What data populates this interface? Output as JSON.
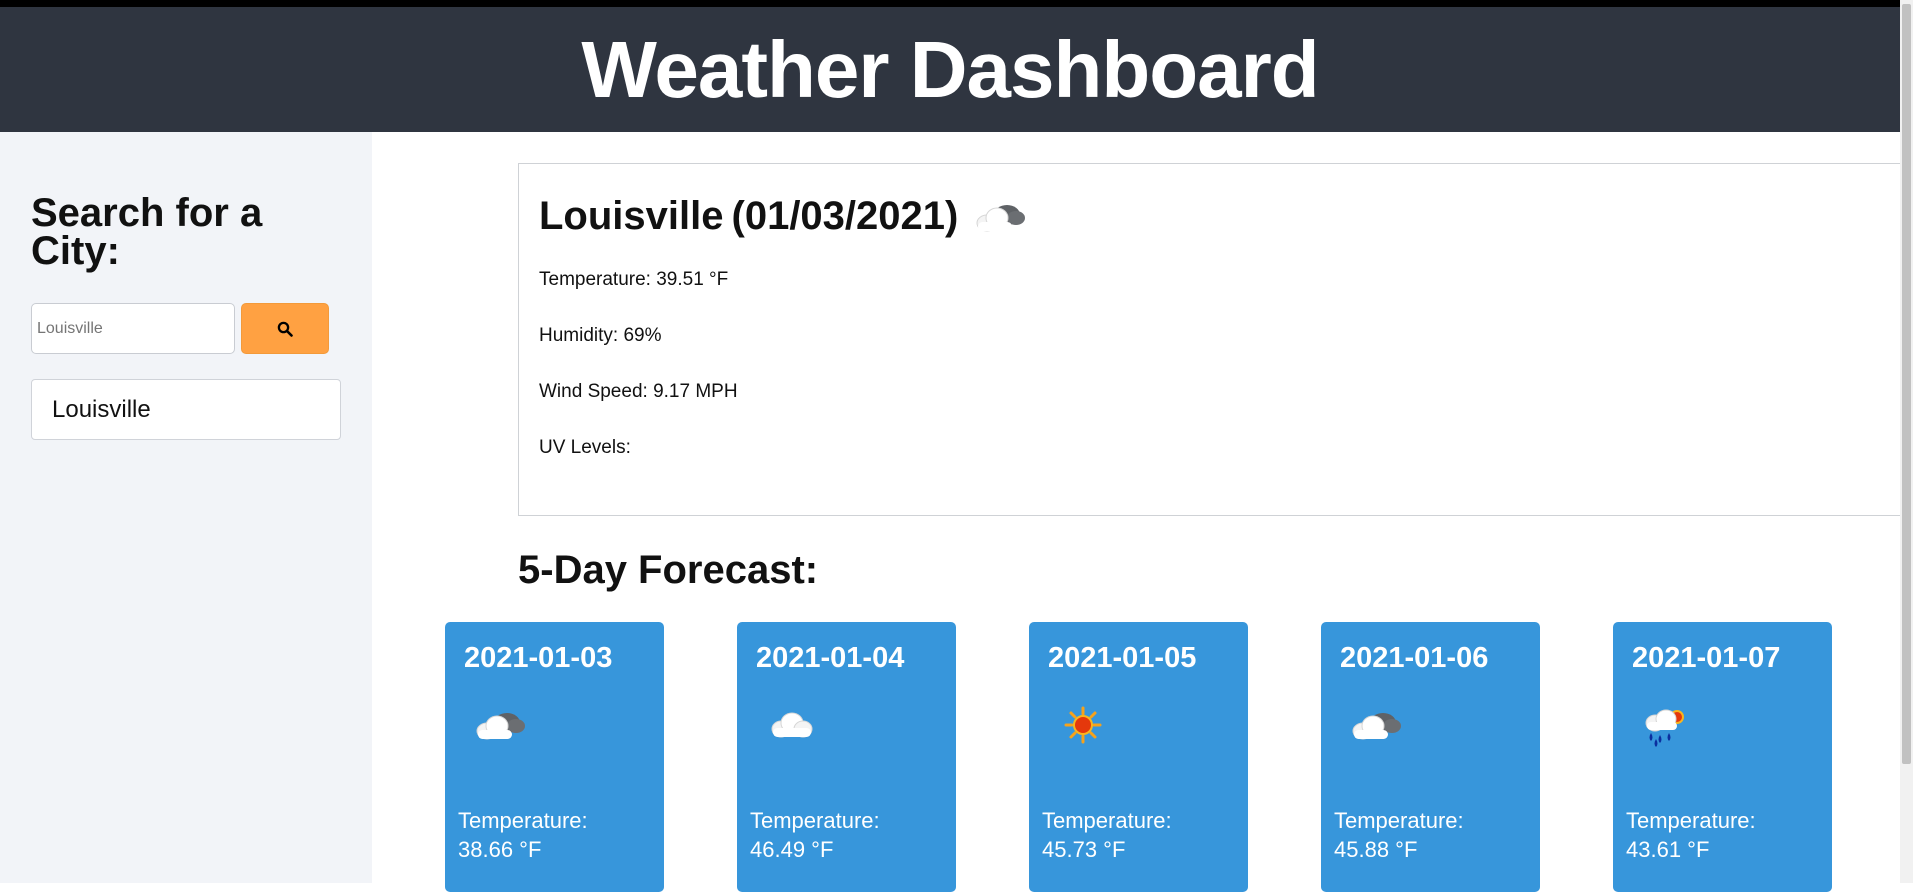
{
  "header": {
    "title": "Weather Dashboard"
  },
  "sidebar": {
    "heading": "Search for a City:",
    "search_input": {
      "value": "",
      "placeholder": "Louisville"
    },
    "search_button_icon": "search-icon",
    "history": [
      {
        "label": "Louisville"
      }
    ]
  },
  "current": {
    "city": "Louisville",
    "date": "(01/03/2021)",
    "icon": "partly-cloudy-icon",
    "temperature": "Temperature: 39.51 °F",
    "humidity": "Humidity: 69%",
    "wind": "Wind Speed: 9.17 MPH",
    "uv": "UV Levels:"
  },
  "forecast": {
    "heading": "5-Day Forecast:",
    "days": [
      {
        "date": "2021-01-03",
        "icon": "partly-cloudy-icon",
        "temp_label": "Temperature:",
        "temp_value": "38.66 °F"
      },
      {
        "date": "2021-01-04",
        "icon": "cloud-icon",
        "temp_label": "Temperature:",
        "temp_value": "46.49 °F"
      },
      {
        "date": "2021-01-05",
        "icon": "sun-icon",
        "temp_label": "Temperature:",
        "temp_value": "45.73 °F"
      },
      {
        "date": "2021-01-06",
        "icon": "partly-cloudy-icon",
        "temp_label": "Temperature:",
        "temp_value": "45.88 °F"
      },
      {
        "date": "2021-01-07",
        "icon": "rain-icon",
        "temp_label": "Temperature:",
        "temp_value": "43.61 °F"
      }
    ]
  },
  "colors": {
    "header_bg": "#2f3540",
    "sidebar_bg": "#f2f4f8",
    "search_button": "#ffa142",
    "card_bg": "#3796db"
  }
}
